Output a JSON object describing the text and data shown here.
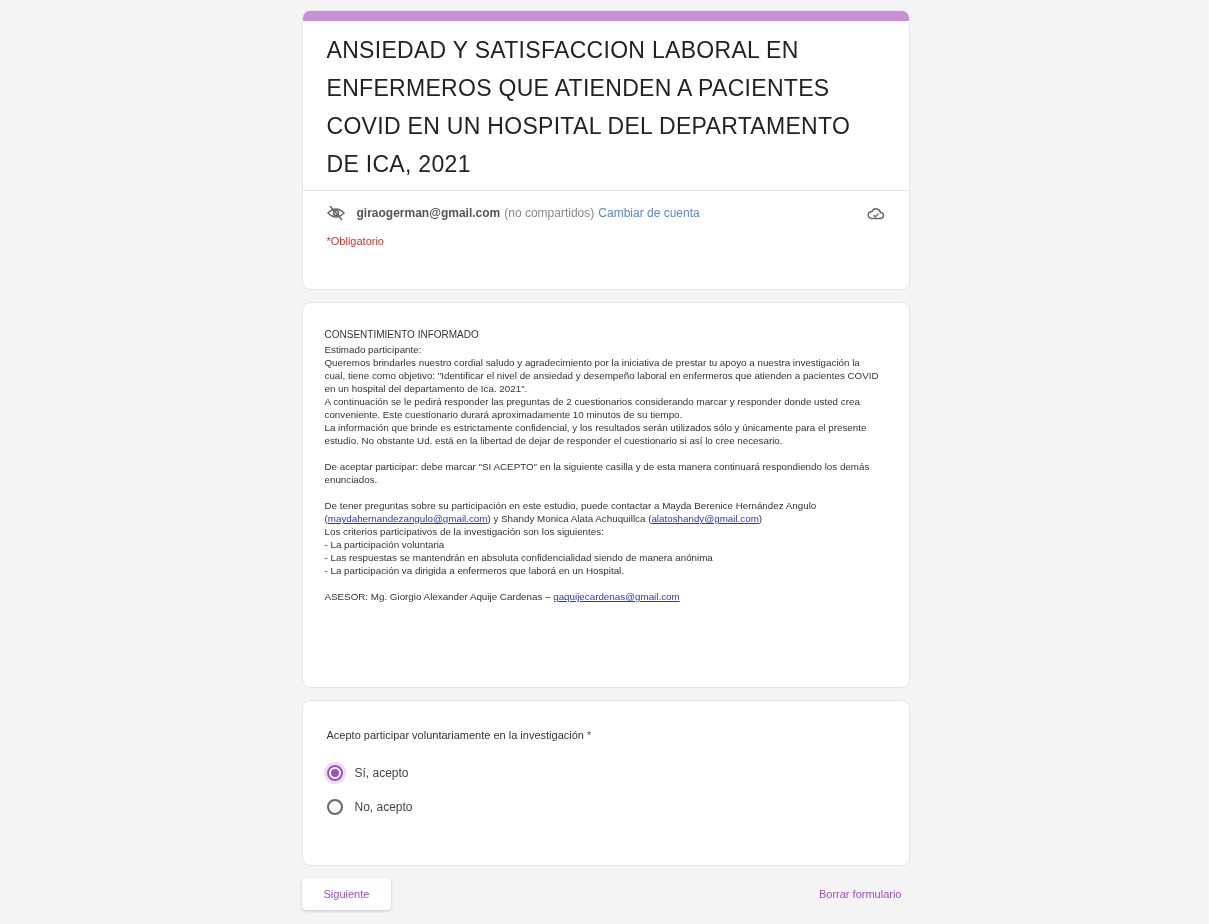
{
  "form": {
    "title": "ANSIEDAD Y SATISFACCION LABORAL EN ENFERMEROS QUE ATIENDEN A PACIENTES COVID EN UN HOSPITAL DEL DEPARTAMENTO DE ICA, 2021",
    "account": {
      "email": "giraogerman@gmail.com",
      "note": "(no compartidos)",
      "switch_link": "Cambiar de cuenta"
    },
    "required_note": "*Obligatorio"
  },
  "consent": {
    "heading": "CONSENTIMIENTO INFORMADO",
    "paragraphs": [
      {
        "lines": [
          [
            {
              "kind": "text",
              "text": "Estimado participante:"
            }
          ],
          [
            {
              "kind": "text",
              "text": "Queremos brindarles nuestro cordial saludo y agradecimiento por la iniciativa de prestar tu apoyo a nuestra investigación la"
            }
          ],
          [
            {
              "kind": "text",
              "text": "cual, tiene como objetivo: \"Identificar el nivel de ansiedad y desempeño laboral en enfermeros que atienden a pacientes COVID"
            }
          ],
          [
            {
              "kind": "text",
              "text": "en un hospital del departamento de  Ica. 2021\"."
            }
          ],
          [
            {
              "kind": "text",
              "text": "A continuación se le pedirá responder las preguntas de 2 cuestionarios considerando marcar y responder donde usted crea"
            }
          ],
          [
            {
              "kind": "text",
              "text": "conveniente. Este cuestionario durará aproximadamente 10 minutos de su tiempo."
            }
          ],
          [
            {
              "kind": "text",
              "text": "La información que brinde es estrictamente confidencial, y los resultados serán utilizados sólo y únicamente para el presente"
            }
          ],
          [
            {
              "kind": "text",
              "text": "estudio. No obstante Ud. está en la libertad de dejar de responder el cuestionario si así lo cree necesario."
            }
          ]
        ]
      },
      {
        "lines": [
          [
            {
              "kind": "text",
              "text": "De aceptar participar: debe marcar \"SI ACEPTO\" en la siguiente casilla y de esta manera continuará respondiendo los demás"
            }
          ],
          [
            {
              "kind": "text",
              "text": "enunciados."
            }
          ]
        ]
      },
      {
        "lines": [
          [
            {
              "kind": "text",
              "text": "De tener preguntas sobre su participación en este estudio, puede contactar a Mayda Berenice Hernández Angulo"
            }
          ],
          [
            {
              "kind": "text",
              "text": "("
            },
            {
              "kind": "link",
              "text": "maydahernandezangulo@gmail.com"
            },
            {
              "kind": "text",
              "text": ") y Shandy Monica Alata Achuquillca ("
            },
            {
              "kind": "link",
              "text": "alatoshandy@gmail.com"
            },
            {
              "kind": "text",
              "text": ")"
            }
          ],
          [
            {
              "kind": "text",
              "text": "Los criterios participativos de la investigación son los siguientes:"
            }
          ],
          [
            {
              "kind": "text",
              "text": "- La participación voluntaria"
            }
          ],
          [
            {
              "kind": "text",
              "text": "- Las respuestas se mantendrán en absoluta confidencialidad siendo de manera anónima"
            }
          ],
          [
            {
              "kind": "text",
              "text": "- La participación va dirigida a enfermeros que laborá en un Hospital."
            }
          ]
        ]
      },
      {
        "lines": [
          [
            {
              "kind": "text",
              "text": "ASESOR: Mg. Giorgio Alexander Aquije Cardenas  – "
            },
            {
              "kind": "link",
              "text": "gaquijecardenas@gmail.com"
            }
          ]
        ]
      }
    ]
  },
  "question": {
    "text": "Acepto participar voluntariamente en la investigación",
    "required_mark": "*",
    "options": [
      {
        "label": "Sí, acepto",
        "selected": true
      },
      {
        "label": "No, acepto",
        "selected": false
      }
    ]
  },
  "actions": {
    "next": "Siguiente",
    "clear": "Borrar formulario"
  }
}
